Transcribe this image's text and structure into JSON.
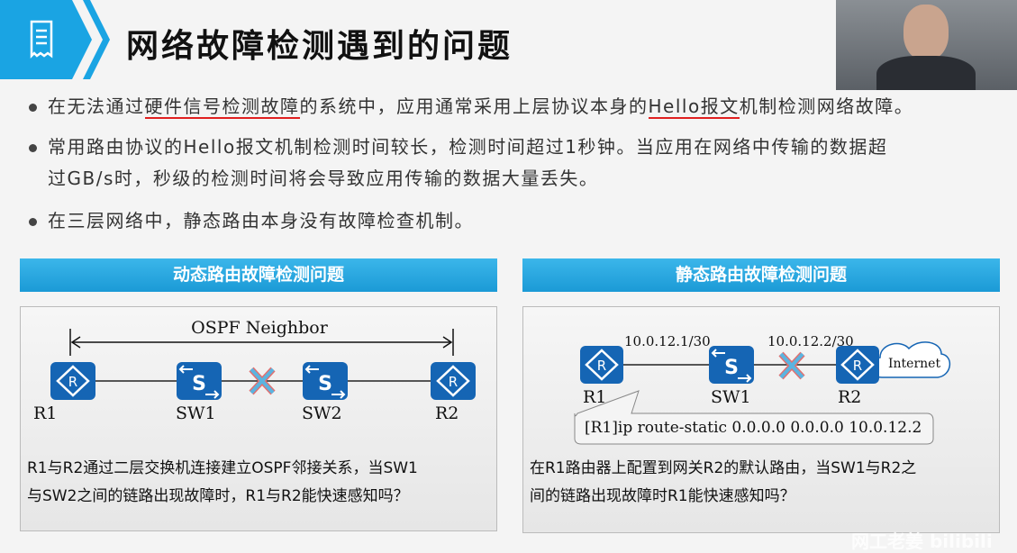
{
  "title": "网络故障检测遇到的问题",
  "title_icon": "document-list-icon",
  "bullets": [
    {
      "pre": "在无法通过",
      "u1": "硬件信号检测故障",
      "mid": "的系统中，应用通常采用上层协议本身的",
      "u2": "Hello报文",
      "post": "机制检测网络故障。"
    },
    {
      "line1": "常用路由协议的Hello报文机制检测时间较长，检测时间超过1秒钟。当应用在网络中传输的数据超",
      "line2": "过GB/s时，秒级的检测时间将会导致应用传输的数据大量丢失。"
    },
    {
      "text": "在三层网络中，静态路由本身没有故障检查机制。"
    }
  ],
  "left_panel": {
    "header": "动态路由故障检测问题",
    "neighbor": "OSPF Neighbor",
    "devices": [
      "R1",
      "SW1",
      "SW2",
      "R2"
    ],
    "line1": "R1与R2通过二层交换机连接建立OSPF邻接关系，当SW1",
    "line2": "与SW2之间的链路出现故障时，R1与R2能快速感知吗？"
  },
  "right_panel": {
    "header": "静态路由故障检测问题",
    "ip1": "10.0.12.1/30",
    "ip2": "10.0.12.2/30",
    "cloud": "Internet",
    "devices": [
      "R1",
      "SW1",
      "R2"
    ],
    "command": "[R1]ip route-static 0.0.0.0 0.0.0.0 10.0.12.2",
    "line1": "在R1路由器上配置到网关R2的默认路由，当SW1与R2之",
    "line2": "间的链路出现故障时R1能快速感知吗？"
  },
  "watermark": "网工老姜 bilibili",
  "colors": {
    "accent": "#1b9ad6",
    "device": "#1565b4",
    "fault": "#e05050"
  }
}
